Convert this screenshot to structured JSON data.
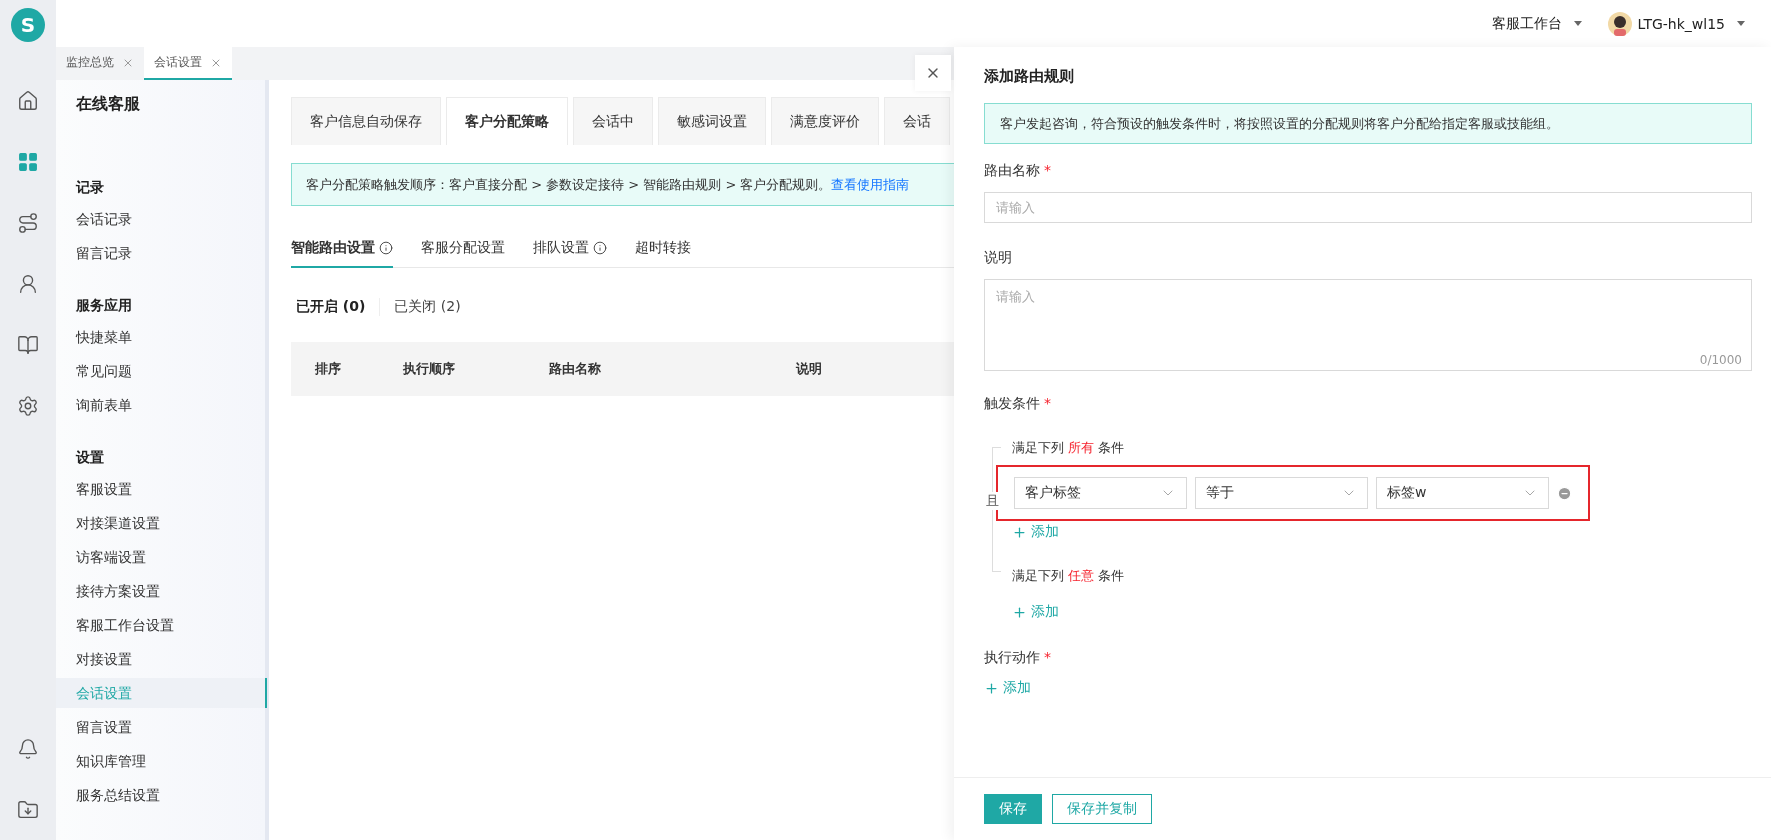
{
  "logo": "S",
  "rail": [
    {
      "kind": "home",
      "selected": false
    },
    {
      "kind": "apps",
      "selected": true
    },
    {
      "kind": "route",
      "selected": false
    },
    {
      "kind": "user",
      "selected": false
    },
    {
      "kind": "book",
      "selected": false
    },
    {
      "kind": "settings",
      "selected": false
    }
  ],
  "rail_bottom": [
    {
      "kind": "bell"
    },
    {
      "kind": "download"
    }
  ],
  "header": {
    "workspace": "客服工作台",
    "user": "LTG-hk_wl15"
  },
  "page_tabs": [
    {
      "label": "监控总览",
      "selected": false
    },
    {
      "label": "会话设置",
      "selected": true
    }
  ],
  "sidebar": {
    "title": "在线客服",
    "sections": [
      {
        "title": "记录",
        "items": [
          {
            "label": "会话记录",
            "selected": false
          },
          {
            "label": "留言记录",
            "selected": false
          }
        ]
      },
      {
        "title": "服务应用",
        "items": [
          {
            "label": "快捷菜单",
            "selected": false
          },
          {
            "label": "常见问题",
            "selected": false
          },
          {
            "label": "询前表单",
            "selected": false
          }
        ]
      },
      {
        "title": "设置",
        "items": [
          {
            "label": "客服设置",
            "selected": false
          },
          {
            "label": "对接渠道设置",
            "selected": false
          },
          {
            "label": "访客端设置",
            "selected": false
          },
          {
            "label": "接待方案设置",
            "selected": false
          },
          {
            "label": "客服工作台设置",
            "selected": false
          },
          {
            "label": "对接设置",
            "selected": false
          },
          {
            "label": "会话设置",
            "selected": true
          },
          {
            "label": "留言设置",
            "selected": false
          },
          {
            "label": "知识库管理",
            "selected": false
          },
          {
            "label": "服务总结设置",
            "selected": false
          }
        ]
      }
    ]
  },
  "content_tabs": [
    {
      "label": "客户信息自动保存",
      "selected": false
    },
    {
      "label": "客户分配策略",
      "selected": true
    },
    {
      "label": "会话中",
      "selected": false
    },
    {
      "label": "敏感词设置",
      "selected": false
    },
    {
      "label": "满意度评价",
      "selected": false
    },
    {
      "label": "会话",
      "selected": false
    }
  ],
  "notice": {
    "text": "客户分配策略触发顺序：客户直接分配 > 参数设定接待 > 智能路由规则 > 客户分配规则。",
    "link": "查看使用指南"
  },
  "sub_tabs": [
    {
      "label": "智能路由设置",
      "info": true,
      "selected": true
    },
    {
      "label": "客服分配设置",
      "info": false,
      "selected": false
    },
    {
      "label": "排队设置",
      "info": true,
      "selected": false
    },
    {
      "label": "超时转接",
      "info": false,
      "selected": false
    }
  ],
  "filters": [
    {
      "label": "已开启 (0)",
      "selected": true
    },
    {
      "label": "已关闭 (2)",
      "selected": false
    }
  ],
  "table": {
    "columns": [
      "排序",
      "执行顺序",
      "路由名称",
      "说明"
    ]
  },
  "drawer": {
    "title": "添加路由规则",
    "notice": "客户发起咨询，符合预设的触发条件时，将按照设置的分配规则将客户分配给指定客服或技能组。",
    "name_field": {
      "label": "路由名称",
      "required_mark": "*",
      "placeholder": "请输入"
    },
    "desc_field": {
      "label": "说明",
      "placeholder": "请输入",
      "counter": "0/1000"
    },
    "conditions": {
      "label": "触发条件",
      "required_mark": "*",
      "joiner": "且",
      "groups": [
        {
          "prefix": "满足下列",
          "keyword": "所有",
          "suffix": "条件",
          "rows": [
            {
              "highlighted": true,
              "selects": [
                "客户标签",
                "等于",
                "标签w"
              ]
            }
          ],
          "add_label": "添加"
        },
        {
          "prefix": "满足下列",
          "keyword": "任意",
          "suffix": "条件",
          "add_label": "添加"
        }
      ]
    },
    "actions": {
      "label": "执行动作",
      "required_mark": "*",
      "add_label": "添加"
    },
    "buttons": [
      {
        "label": "保存",
        "kind": "primary"
      },
      {
        "label": "保存并复制",
        "kind": "outline"
      }
    ]
  }
}
